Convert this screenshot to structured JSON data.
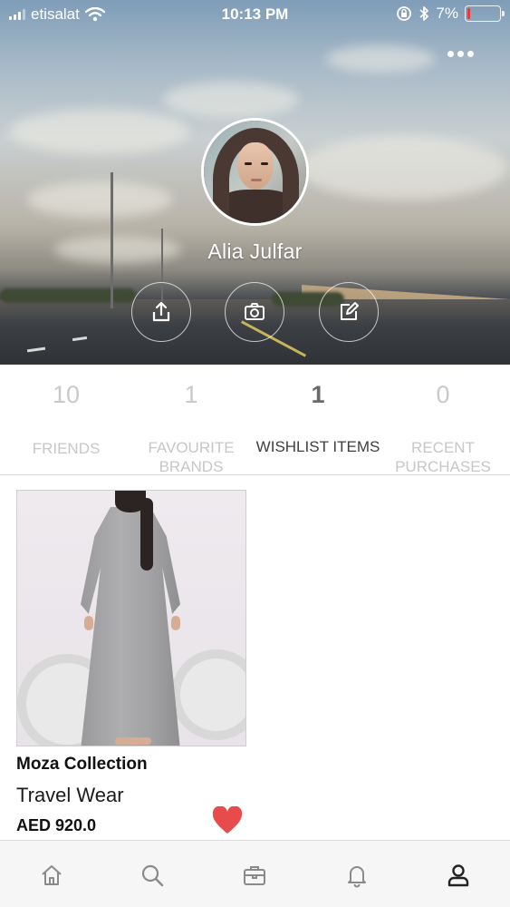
{
  "status_bar": {
    "carrier": "etisalat",
    "time": "10:13 PM",
    "battery_percent": "7%",
    "battery_level": 0.07,
    "icons": [
      "signal-icon",
      "wifi-icon",
      "orientation-lock-icon",
      "bluetooth-icon",
      "battery-icon"
    ]
  },
  "header": {
    "more_icon": "more-dots-icon",
    "profile_name": "Alia Julfar",
    "actions": [
      {
        "name": "share",
        "icon": "share-icon"
      },
      {
        "name": "camera",
        "icon": "camera-icon"
      },
      {
        "name": "edit",
        "icon": "edit-icon"
      }
    ]
  },
  "stats": [
    {
      "count": "10",
      "label": "FRIENDS",
      "active": false
    },
    {
      "count": "1",
      "label": "FAVOURITE BRANDS",
      "active": false
    },
    {
      "count": "1",
      "label": "WISHLIST ITEMS",
      "active": true
    },
    {
      "count": "0",
      "label": "RECENT PURCHASES",
      "active": false
    }
  ],
  "wishlist": [
    {
      "brand": "Moza Collection",
      "name": "Travel Wear",
      "price": "AED 920.0",
      "favourited": true
    }
  ],
  "tabbar": {
    "items": [
      {
        "name": "home",
        "icon": "home-icon",
        "active": false
      },
      {
        "name": "search",
        "icon": "search-icon",
        "active": false
      },
      {
        "name": "shop",
        "icon": "briefcase-icon",
        "active": false
      },
      {
        "name": "notifications",
        "icon": "bell-icon",
        "active": false
      },
      {
        "name": "profile",
        "icon": "user-icon",
        "active": true
      }
    ]
  },
  "colors": {
    "heart": "#e84b4b",
    "active_text": "#3f3f3f",
    "inactive_text": "#c7c7c7",
    "tab_icon": "#8a8a8a",
    "tab_icon_active": "#222222"
  }
}
